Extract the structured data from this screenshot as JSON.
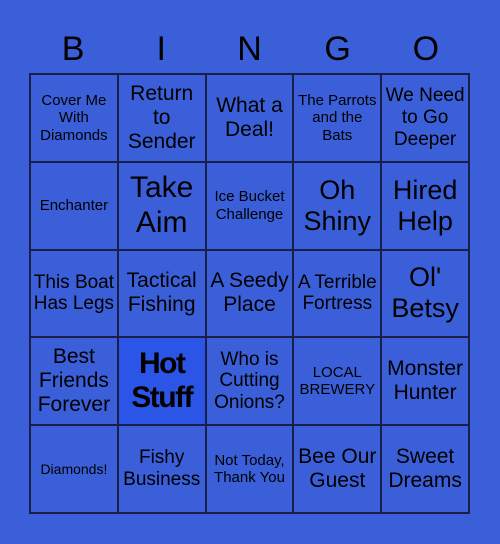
{
  "header": {
    "letters": [
      "B",
      "I",
      "N",
      "G",
      "O"
    ]
  },
  "board": {
    "cells": [
      "Cover Me With Diamonds",
      "Return to Sender",
      "What a Deal!",
      "The Parrots and the Bats",
      "We Need to Go Deeper",
      "Enchanter",
      "Take Aim",
      "Ice Bucket Challenge",
      "Oh Shiny",
      "Hired Help",
      "This Boat Has Legs",
      "Tactical Fishing",
      "A Seedy Place",
      "A Terrible Fortress",
      "Ol' Betsy",
      "Best Friends Forever",
      "Hot Stuff",
      "Who is Cutting Onions?",
      "LOCAL BREWERY",
      "Monster Hunter",
      "Diamonds!",
      "Fishy Business",
      "Not Today, Thank You",
      "Bee Our Guest",
      "Sweet Dreams"
    ],
    "free_space_index": 16
  },
  "colors": {
    "background": "#3a5fd9",
    "free_cell": "#2b55e6",
    "grid_line": "#1a1f4a",
    "text": "#000000"
  }
}
